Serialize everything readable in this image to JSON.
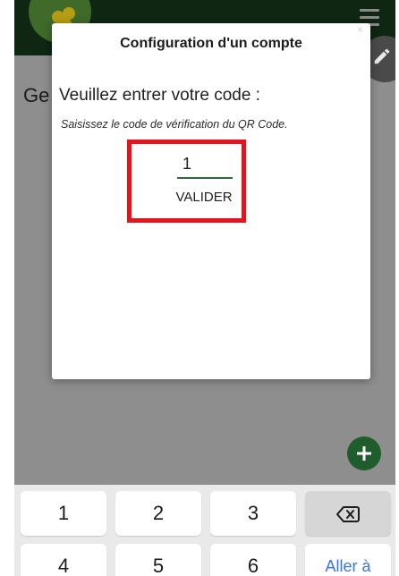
{
  "background": {
    "heading_fragment": "Ge"
  },
  "dialog": {
    "title": "Configuration d'un compte",
    "close_glyph": "×",
    "heading": "Veuillez entrer votre code :",
    "hint": "Saisissez le code de vérification du QR Code.",
    "code_value": "1",
    "validate_label": "VALIDER"
  },
  "keyboard": {
    "row1": [
      "1",
      "2",
      "3"
    ],
    "row2": [
      "4",
      "5",
      "6"
    ],
    "go_label": "Aller à",
    "backspace_icon": "backspace-icon"
  },
  "colors": {
    "app_bar": "#0e2612",
    "accent_green": "#1f5d2c",
    "highlight_red": "#e0161d",
    "keyboard_go": "#3a74e8"
  }
}
